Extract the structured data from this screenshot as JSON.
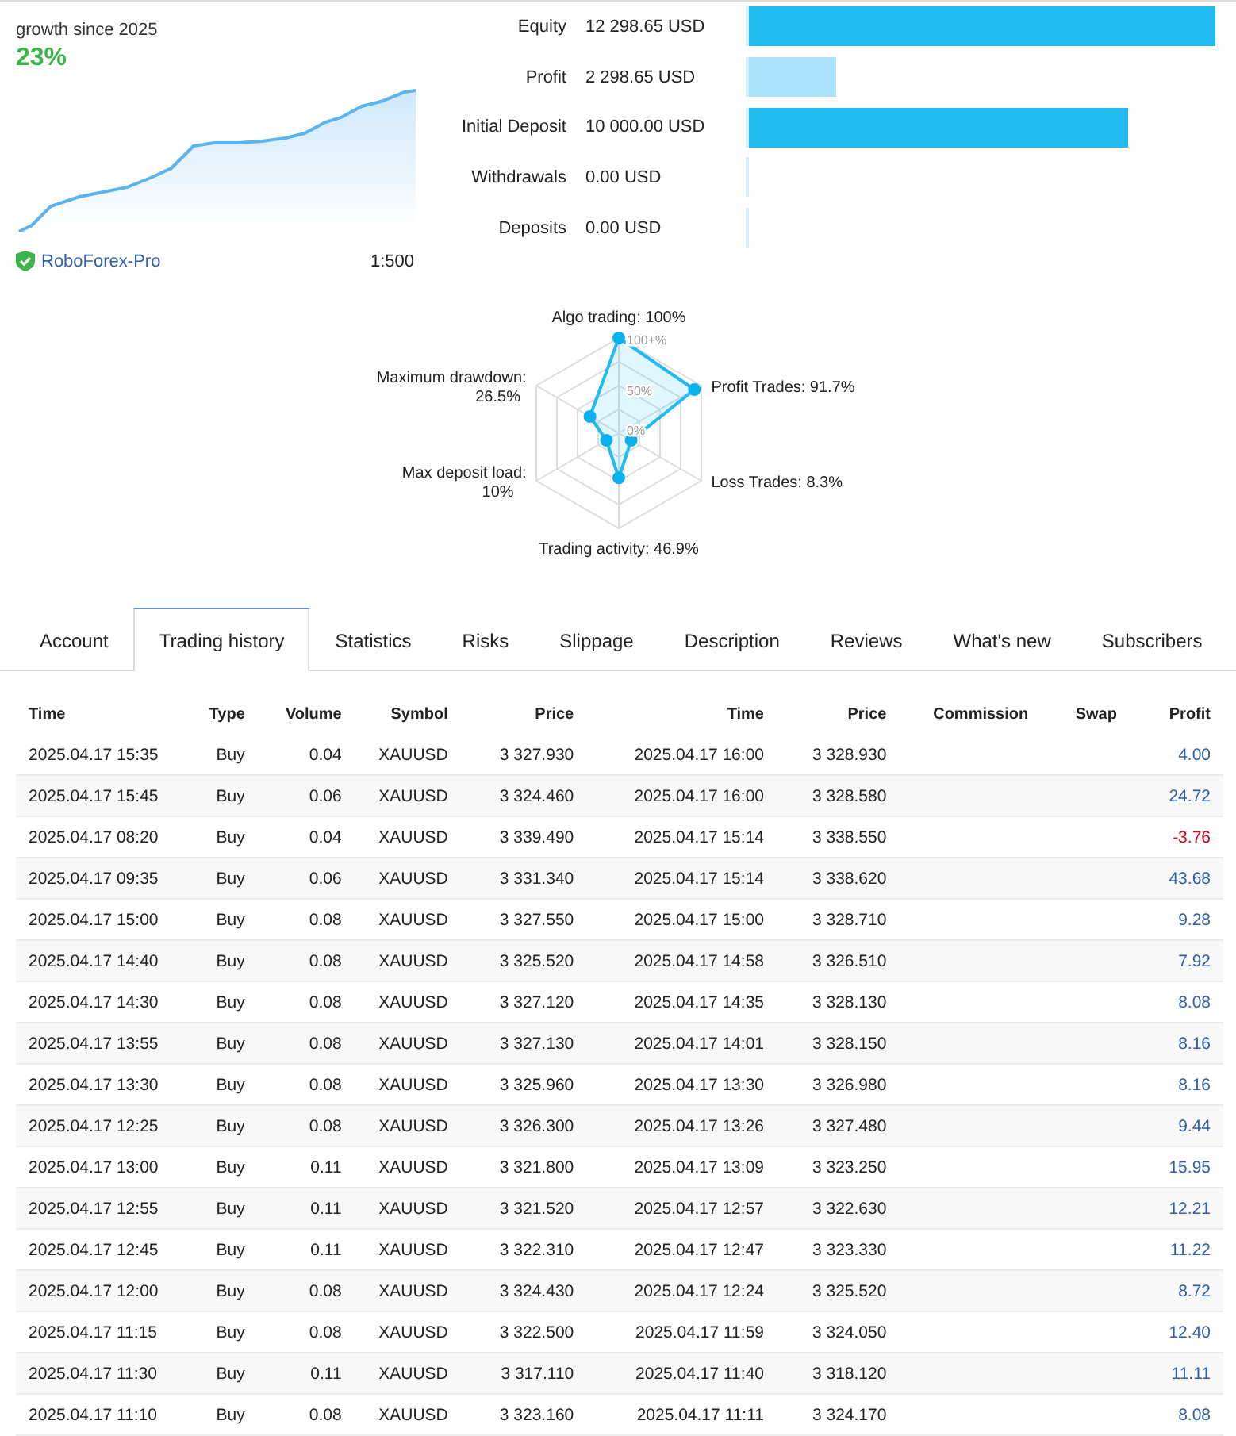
{
  "growth": {
    "caption": "growth since 2025",
    "value": "23%"
  },
  "server": {
    "name": "RoboForex-Pro",
    "verified": true,
    "leverage": "1:500"
  },
  "balances": [
    {
      "label": "Equity",
      "value": "12 298.65 USD",
      "level": 1.0,
      "color": "#22bbf0"
    },
    {
      "label": "Profit",
      "value": "2 298.65 USD",
      "level": 0.187,
      "color": "#aae3fb"
    },
    {
      "label": "Initial Deposit",
      "value": "10 000.00 USD",
      "level": 0.813,
      "color": "#22bbf0"
    },
    {
      "label": "Withdrawals",
      "value": "0.00 USD",
      "level": 0
    },
    {
      "label": "Deposits",
      "value": "0.00 USD",
      "level": 0
    }
  ],
  "radar": {
    "ticks": [
      "100+%",
      "50%",
      "0%"
    ],
    "axes": [
      {
        "label": "Algo trading: 100%",
        "kind": "top"
      },
      {
        "label": "Maximum drawdown:",
        "value": "26.5%",
        "kind": "upper-left"
      },
      {
        "label": "Profit Trades: 91.7%",
        "kind": "upper-right"
      },
      {
        "label": "Max deposit load:",
        "value": "10%",
        "kind": "lower-left"
      },
      {
        "label": "Loss Trades: 8.3%",
        "kind": "lower-right"
      },
      {
        "label": "Trading activity: 46.9%",
        "kind": "bottom"
      }
    ]
  },
  "tabs": [
    {
      "label": "Account",
      "selected": false
    },
    {
      "label": "Trading history",
      "selected": true
    },
    {
      "label": "Statistics",
      "selected": false
    },
    {
      "label": "Risks",
      "selected": false
    },
    {
      "label": "Slippage",
      "selected": false
    },
    {
      "label": "Description",
      "selected": false
    },
    {
      "label": "Reviews",
      "selected": false
    },
    {
      "label": "What's new",
      "selected": false
    },
    {
      "label": "Subscribers",
      "selected": false
    }
  ],
  "table": {
    "columns": [
      "Time",
      "Type",
      "Volume",
      "Symbol",
      "Price",
      "Time",
      "Price",
      "Commission",
      "Swap",
      "Profit"
    ],
    "rows": [
      {
        "cells": [
          "2025.04.17 15:35",
          "Buy",
          "0.04",
          "XAUUSD",
          "3 327.930",
          "2025.04.17 16:00",
          "3 328.930",
          "",
          "",
          "4.00"
        ],
        "loss": false
      },
      {
        "cells": [
          "2025.04.17 15:45",
          "Buy",
          "0.06",
          "XAUUSD",
          "3 324.460",
          "2025.04.17 16:00",
          "3 328.580",
          "",
          "",
          "24.72"
        ],
        "loss": false
      },
      {
        "cells": [
          "2025.04.17 08:20",
          "Buy",
          "0.04",
          "XAUUSD",
          "3 339.490",
          "2025.04.17 15:14",
          "3 338.550",
          "",
          "",
          "-3.76"
        ],
        "loss": true
      },
      {
        "cells": [
          "2025.04.17 09:35",
          "Buy",
          "0.06",
          "XAUUSD",
          "3 331.340",
          "2025.04.17 15:14",
          "3 338.620",
          "",
          "",
          "43.68"
        ],
        "loss": false
      },
      {
        "cells": [
          "2025.04.17 15:00",
          "Buy",
          "0.08",
          "XAUUSD",
          "3 327.550",
          "2025.04.17 15:00",
          "3 328.710",
          "",
          "",
          "9.28"
        ],
        "loss": false
      },
      {
        "cells": [
          "2025.04.17 14:40",
          "Buy",
          "0.08",
          "XAUUSD",
          "3 325.520",
          "2025.04.17 14:58",
          "3 326.510",
          "",
          "",
          "7.92"
        ],
        "loss": false
      },
      {
        "cells": [
          "2025.04.17 14:30",
          "Buy",
          "0.08",
          "XAUUSD",
          "3 327.120",
          "2025.04.17 14:35",
          "3 328.130",
          "",
          "",
          "8.08"
        ],
        "loss": false
      },
      {
        "cells": [
          "2025.04.17 13:55",
          "Buy",
          "0.08",
          "XAUUSD",
          "3 327.130",
          "2025.04.17 14:01",
          "3 328.150",
          "",
          "",
          "8.16"
        ],
        "loss": false
      },
      {
        "cells": [
          "2025.04.17 13:30",
          "Buy",
          "0.08",
          "XAUUSD",
          "3 325.960",
          "2025.04.17 13:30",
          "3 326.980",
          "",
          "",
          "8.16"
        ],
        "loss": false
      },
      {
        "cells": [
          "2025.04.17 12:25",
          "Buy",
          "0.08",
          "XAUUSD",
          "3 326.300",
          "2025.04.17 13:26",
          "3 327.480",
          "",
          "",
          "9.44"
        ],
        "loss": false
      },
      {
        "cells": [
          "2025.04.17 13:00",
          "Buy",
          "0.11",
          "XAUUSD",
          "3 321.800",
          "2025.04.17 13:09",
          "3 323.250",
          "",
          "",
          "15.95"
        ],
        "loss": false
      },
      {
        "cells": [
          "2025.04.17 12:55",
          "Buy",
          "0.11",
          "XAUUSD",
          "3 321.520",
          "2025.04.17 12:57",
          "3 322.630",
          "",
          "",
          "12.21"
        ],
        "loss": false
      },
      {
        "cells": [
          "2025.04.17 12:45",
          "Buy",
          "0.11",
          "XAUUSD",
          "3 322.310",
          "2025.04.17 12:47",
          "3 323.330",
          "",
          "",
          "11.22"
        ],
        "loss": false
      },
      {
        "cells": [
          "2025.04.17 12:00",
          "Buy",
          "0.08",
          "XAUUSD",
          "3 324.430",
          "2025.04.17 12:24",
          "3 325.520",
          "",
          "",
          "8.72"
        ],
        "loss": false
      },
      {
        "cells": [
          "2025.04.17 11:15",
          "Buy",
          "0.08",
          "XAUUSD",
          "3 322.500",
          "2025.04.17 11:59",
          "3 324.050",
          "",
          "",
          "12.40"
        ],
        "loss": false
      },
      {
        "cells": [
          "2025.04.17 11:30",
          "Buy",
          "0.11",
          "XAUUSD",
          "3 317.110",
          "2025.04.17 11:40",
          "3 318.120",
          "",
          "",
          "11.11"
        ],
        "loss": false
      },
      {
        "cells": [
          "2025.04.17 11:10",
          "Buy",
          "0.08",
          "XAUUSD",
          "3 323.160",
          "2025.04.17 11:11",
          "3 324.170",
          "",
          "",
          "8.08"
        ],
        "loss": false
      }
    ]
  }
}
